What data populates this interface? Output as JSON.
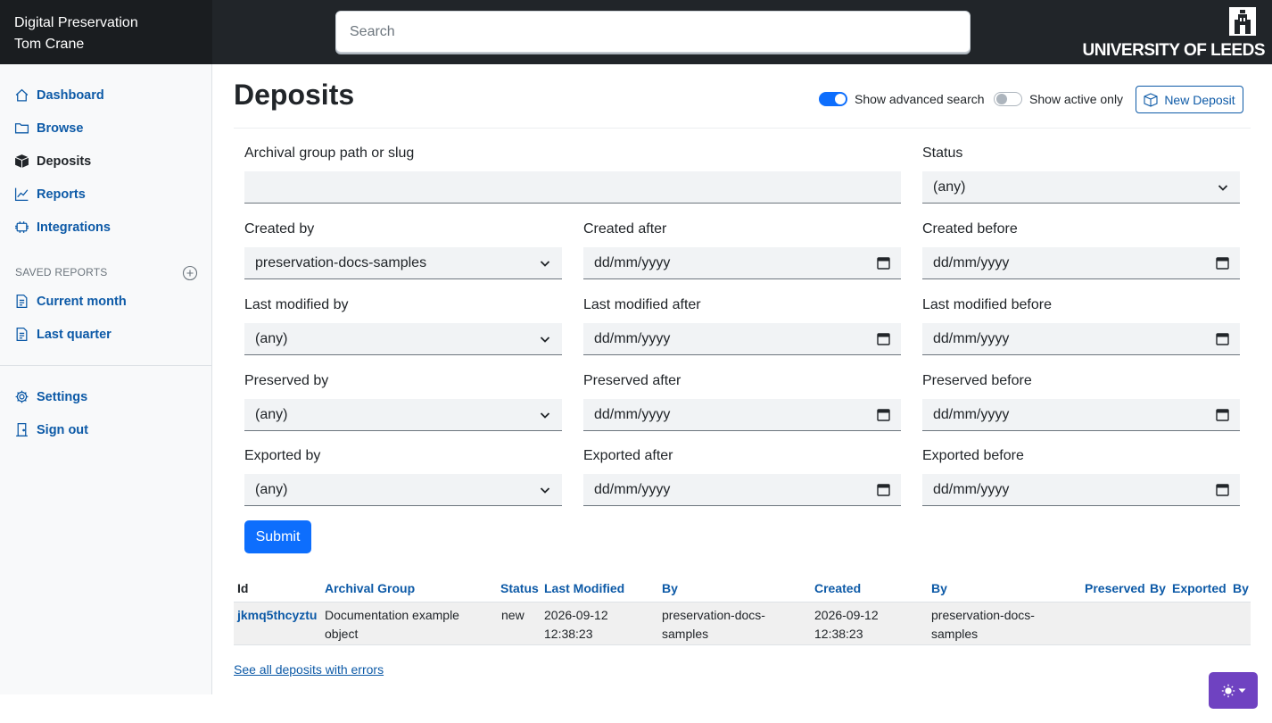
{
  "header": {
    "app_title": "Digital Preservation",
    "user_name": "Tom Crane",
    "search_placeholder": "Search",
    "logo_text": "UNIVERSITY OF LEEDS"
  },
  "sidebar": {
    "items": [
      {
        "label": "Dashboard",
        "icon": "house-icon"
      },
      {
        "label": "Browse",
        "icon": "folder-icon"
      },
      {
        "label": "Deposits",
        "icon": "box-icon",
        "active": true
      },
      {
        "label": "Reports",
        "icon": "chart-line-icon"
      },
      {
        "label": "Integrations",
        "icon": "plugin-icon"
      }
    ],
    "saved_reports_heading": "SAVED REPORTS",
    "saved_reports": [
      {
        "label": "Current month",
        "icon": "document-icon"
      },
      {
        "label": "Last quarter",
        "icon": "document-icon"
      }
    ],
    "bottom": [
      {
        "label": "Settings",
        "icon": "gear-icon"
      },
      {
        "label": "Sign out",
        "icon": "door-icon"
      }
    ]
  },
  "main": {
    "title": "Deposits",
    "toggle_advanced": {
      "label": "Show advanced search",
      "on": true
    },
    "toggle_active": {
      "label": "Show active only",
      "on": false
    },
    "new_deposit_label": "New Deposit",
    "form": {
      "path_label": "Archival group path or slug",
      "path_value": "",
      "status_label": "Status",
      "status_value": "(any)",
      "created_by_label": "Created by",
      "created_by_value": "preservation-docs-samples",
      "created_after_label": "Created after",
      "created_before_label": "Created before",
      "modified_by_label": "Last modified by",
      "modified_by_value": "(any)",
      "modified_after_label": "Last modified after",
      "modified_before_label": "Last modified before",
      "preserved_by_label": "Preserved by",
      "preserved_by_value": "(any)",
      "preserved_after_label": "Preserved after",
      "preserved_before_label": "Preserved before",
      "exported_by_label": "Exported by",
      "exported_by_value": "(any)",
      "exported_after_label": "Exported after",
      "exported_before_label": "Exported before",
      "date_placeholder": "dd/mm/yyyy",
      "submit_label": "Submit"
    },
    "table": {
      "headers": [
        "Id",
        "Archival Group",
        "Status",
        "Last Modified",
        "By",
        "Created",
        "By",
        "Preserved",
        "By",
        "Exported",
        "By"
      ],
      "rows": [
        {
          "id": "jkmq5thcyztu",
          "archival_group_line1": "Documentation example",
          "archival_group_line2": "object",
          "status": "new",
          "last_modified_date": "2026-09-12",
          "last_modified_time": "12:38:23",
          "modified_by_line1": "preservation-docs-",
          "modified_by_line2": "samples",
          "created_date": "2026-09-12",
          "created_time": "12:38:23",
          "created_by_line1": "preservation-docs-",
          "created_by_line2": "samples"
        }
      ]
    },
    "errors_link": "See all deposits with errors"
  },
  "colors": {
    "topbar": "#212529",
    "link": "#0d5aa7",
    "primary": "#0d6efd",
    "theme_button": "#6f42c1"
  }
}
